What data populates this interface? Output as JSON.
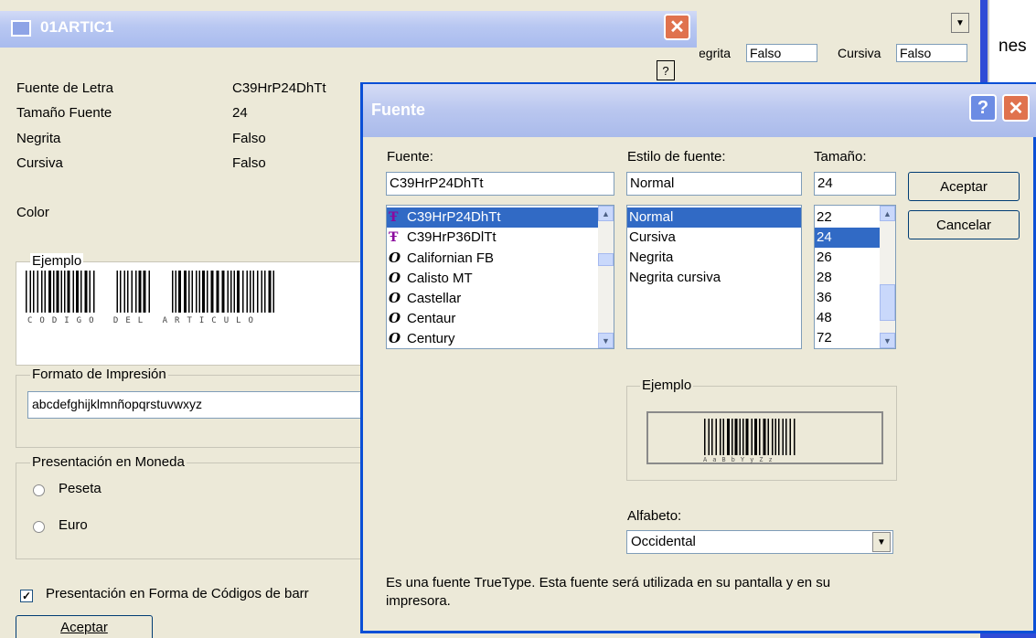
{
  "background_window": {
    "bold_label": "egrita",
    "bold_value": "Falso",
    "italic_label": "Cursiva",
    "italic_value": "Falso",
    "partial_text": "nes"
  },
  "main_window": {
    "title": "01ARTIC1",
    "help_label": "?",
    "properties": [
      {
        "label": "Fuente de Letra",
        "value": "C39HrP24DhTt"
      },
      {
        "label": "Tamaño Fuente",
        "value": "24"
      },
      {
        "label": "Negrita",
        "value": "Falso"
      },
      {
        "label": "Cursiva",
        "value": "Falso"
      }
    ],
    "color_label": "Color",
    "example_group_title": "Ejemplo",
    "barcode_caption": "CODIGO DEL ARTICULO",
    "print_format_group_title": "Formato de Impresión",
    "print_format_value": "abcdefghijklmnñopqrstuvwxyz",
    "currency_group_title": "Presentación en Moneda",
    "currency_options": [
      {
        "label": "Peseta",
        "checked": false
      },
      {
        "label": "Euro",
        "checked": false
      }
    ],
    "barcode_checkbox_label": "Presentación en Forma de Códigos de barr",
    "barcode_checkbox_checked": true,
    "accept_button": "Aceptar"
  },
  "font_dialog": {
    "title": "Fuente",
    "help_label": "?",
    "font_label": "Fuente:",
    "font_value": "C39HrP24DhTt",
    "fonts": [
      {
        "name": "C39HrP24DhTt",
        "icon": "truetype-icon",
        "selected": true
      },
      {
        "name": "C39HrP36DlTt",
        "icon": "truetype-icon",
        "selected": false
      },
      {
        "name": "Californian FB",
        "icon": "opentype-icon",
        "selected": false
      },
      {
        "name": "Calisto MT",
        "icon": "opentype-icon",
        "selected": false
      },
      {
        "name": "Castellar",
        "icon": "opentype-icon",
        "selected": false
      },
      {
        "name": "Centaur",
        "icon": "opentype-icon",
        "selected": false
      },
      {
        "name": "Century",
        "icon": "opentype-icon",
        "selected": false
      }
    ],
    "style_label": "Estilo de fuente:",
    "style_value": "Normal",
    "styles": [
      {
        "name": "Normal",
        "selected": true
      },
      {
        "name": "Cursiva",
        "selected": false
      },
      {
        "name": "Negrita",
        "selected": false
      },
      {
        "name": "Negrita cursiva",
        "selected": false
      }
    ],
    "size_label": "Tamaño:",
    "size_value": "24",
    "sizes": [
      {
        "name": "22",
        "selected": false
      },
      {
        "name": "24",
        "selected": true
      },
      {
        "name": "26",
        "selected": false
      },
      {
        "name": "28",
        "selected": false
      },
      {
        "name": "36",
        "selected": false
      },
      {
        "name": "48",
        "selected": false
      },
      {
        "name": "72",
        "selected": false
      }
    ],
    "accept_button": "Aceptar",
    "cancel_button": "Cancelar",
    "sample_group_title": "Ejemplo",
    "sample_caption": "AaBbYyZz",
    "alphabet_label": "Alfabeto:",
    "alphabet_value": "Occidental",
    "description": "Es una fuente TrueType. Esta fuente será utilizada en su pantalla y en su impresora.",
    "colors": {
      "selection": "#316ac5",
      "frame": "#0a4fd6",
      "close": "#e0724e"
    }
  }
}
